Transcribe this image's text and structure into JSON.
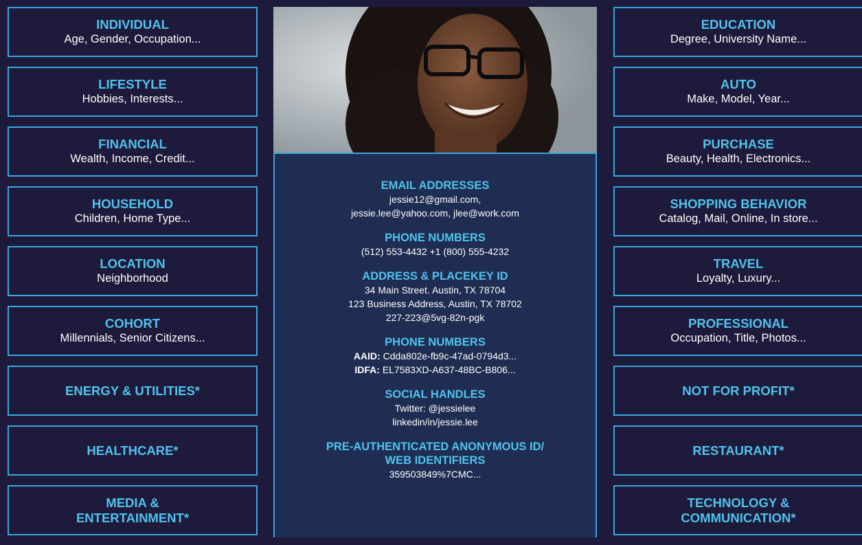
{
  "left_categories": [
    {
      "title": "INDIVIDUAL",
      "subtitle": "Age, Gender, Occupation..."
    },
    {
      "title": "LIFESTYLE",
      "subtitle": "Hobbies, Interests..."
    },
    {
      "title": "FINANCIAL",
      "subtitle": "Wealth, Income, Credit..."
    },
    {
      "title": "HOUSEHOLD",
      "subtitle": "Children, Home Type..."
    },
    {
      "title": "LOCATION",
      "subtitle": "Neighborhood"
    },
    {
      "title": "COHORT",
      "subtitle": "Millennials, Senior Citizens..."
    },
    {
      "title": "ENERGY & UTILITIES*",
      "subtitle": ""
    },
    {
      "title": "HEALTHCARE*",
      "subtitle": ""
    },
    {
      "title": "MEDIA &",
      "title2": "ENTERTAINMENT*",
      "subtitle": ""
    }
  ],
  "right_categories": [
    {
      "title": "EDUCATION",
      "subtitle": "Degree, University Name..."
    },
    {
      "title": "AUTO",
      "subtitle": "Make, Model, Year..."
    },
    {
      "title": "PURCHASE",
      "subtitle": "Beauty, Health, Electronics..."
    },
    {
      "title": "SHOPPING BEHAVIOR",
      "subtitle": "Catalog, Mail, Online, In store..."
    },
    {
      "title": "TRAVEL",
      "subtitle": "Loyalty, Luxury..."
    },
    {
      "title": "PROFESSIONAL",
      "subtitle": "Occupation, Title, Photos..."
    },
    {
      "title": "NOT FOR PROFIT*",
      "subtitle": ""
    },
    {
      "title": "RESTAURANT*",
      "subtitle": ""
    },
    {
      "title": "TECHNOLOGY &",
      "title2": "COMMUNICATION*",
      "subtitle": ""
    }
  ],
  "profile": {
    "email": {
      "heading": "EMAIL ADDRESSES",
      "line1": "jessie12@gmail.com,",
      "line2": "jessie.lee@yahoo.com, jlee@work.com"
    },
    "phone": {
      "heading": "PHONE NUMBERS",
      "line1": "(512) 553-4432 +1 (800) 555-4232"
    },
    "address": {
      "heading": "ADDRESS & PLACEKEY ID",
      "line1": "34 Main Street. Austin, TX  78704",
      "line2": "123 Business Address, Austin, TX 78702",
      "line3": "227-223@5vg-82n-pgk"
    },
    "device": {
      "heading": "PHONE NUMBERS",
      "aaid_label": "AAID:",
      "aaid_value": " Cdda802e-fb9c-47ad-0794d3...",
      "idfa_label": "IDFA:",
      "idfa_value": " EL7583XD-A637-48BC-B806..."
    },
    "social": {
      "heading": "SOCIAL HANDLES",
      "line1": "Twitter:  @jessielee",
      "line2": "linkedin/in/jessie.lee"
    },
    "anon": {
      "heading1": "PRE-AUTHENTICATED ANONYMOUS ID/",
      "heading2": "WEB IDENTIFIERS",
      "line1": "359503849%7CMC..."
    }
  },
  "colors": {
    "background": "#1d1a3b",
    "accent": "#4fc3ec",
    "border": "#3aa6dd",
    "panel": "#1f2d52"
  }
}
